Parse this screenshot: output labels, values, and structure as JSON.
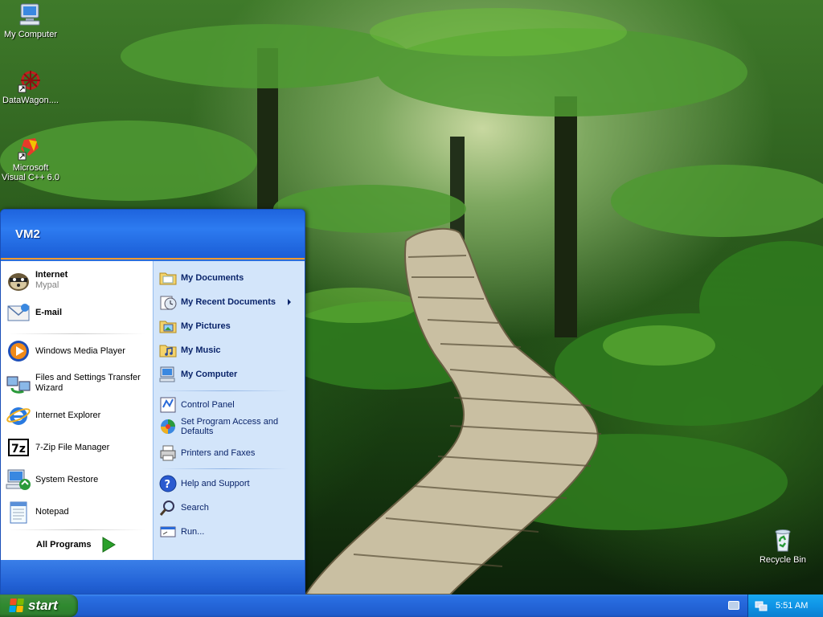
{
  "desktop": {
    "icons": [
      {
        "label": "My Computer",
        "icon": "my-computer-icon"
      },
      {
        "label": "DataWagon....",
        "icon": "datawagon-icon"
      },
      {
        "label": "Microsoft Visual C++ 6.0",
        "icon": "visual-cpp-icon"
      },
      {
        "label": "Recycle Bin",
        "icon": "recycle-bin-icon"
      }
    ]
  },
  "start_menu": {
    "user": "VM2",
    "pinned": [
      {
        "label": "Internet",
        "sub": "Mypal",
        "icon": "mypal-icon"
      },
      {
        "label": "E-mail",
        "icon": "email-icon"
      }
    ],
    "recent": [
      {
        "label": "Windows Media Player",
        "icon": "media-player-icon"
      },
      {
        "label": "Files and Settings Transfer Wizard",
        "icon": "transfer-wizard-icon"
      },
      {
        "label": "Internet Explorer",
        "icon": "internet-explorer-icon"
      },
      {
        "label": "7-Zip File Manager",
        "icon": "7zip-icon"
      },
      {
        "label": "System Restore",
        "icon": "system-restore-icon"
      },
      {
        "label": "Notepad",
        "icon": "notepad-icon"
      }
    ],
    "all_programs": "All Programs",
    "places": [
      {
        "label": "My Documents",
        "icon": "folder-documents-icon"
      },
      {
        "label": "My Recent Documents",
        "icon": "recent-documents-icon"
      },
      {
        "label": "My Pictures",
        "icon": "folder-pictures-icon"
      },
      {
        "label": "My Music",
        "icon": "folder-music-icon"
      },
      {
        "label": "My Computer",
        "icon": "my-computer-icon"
      }
    ],
    "system": [
      {
        "label": "Control Panel",
        "icon": "control-panel-icon"
      },
      {
        "label": "Set Program Access and Defaults",
        "icon": "program-defaults-icon"
      },
      {
        "label": "Printers and Faxes",
        "icon": "printer-icon"
      }
    ],
    "help": [
      {
        "label": "Help and Support",
        "icon": "help-icon"
      },
      {
        "label": "Search",
        "icon": "search-icon"
      },
      {
        "label": "Run...",
        "icon": "run-icon"
      }
    ]
  },
  "taskbar": {
    "start_label": "start",
    "clock": "5:51 AM"
  },
  "colors": {
    "taskbar_blue": "#2465d8",
    "start_green": "#2f8a2f",
    "tray_blue": "#0f94e6",
    "menu_right_bg": "#d3e5fa",
    "menu_accent_orange": "#f09a2e"
  }
}
